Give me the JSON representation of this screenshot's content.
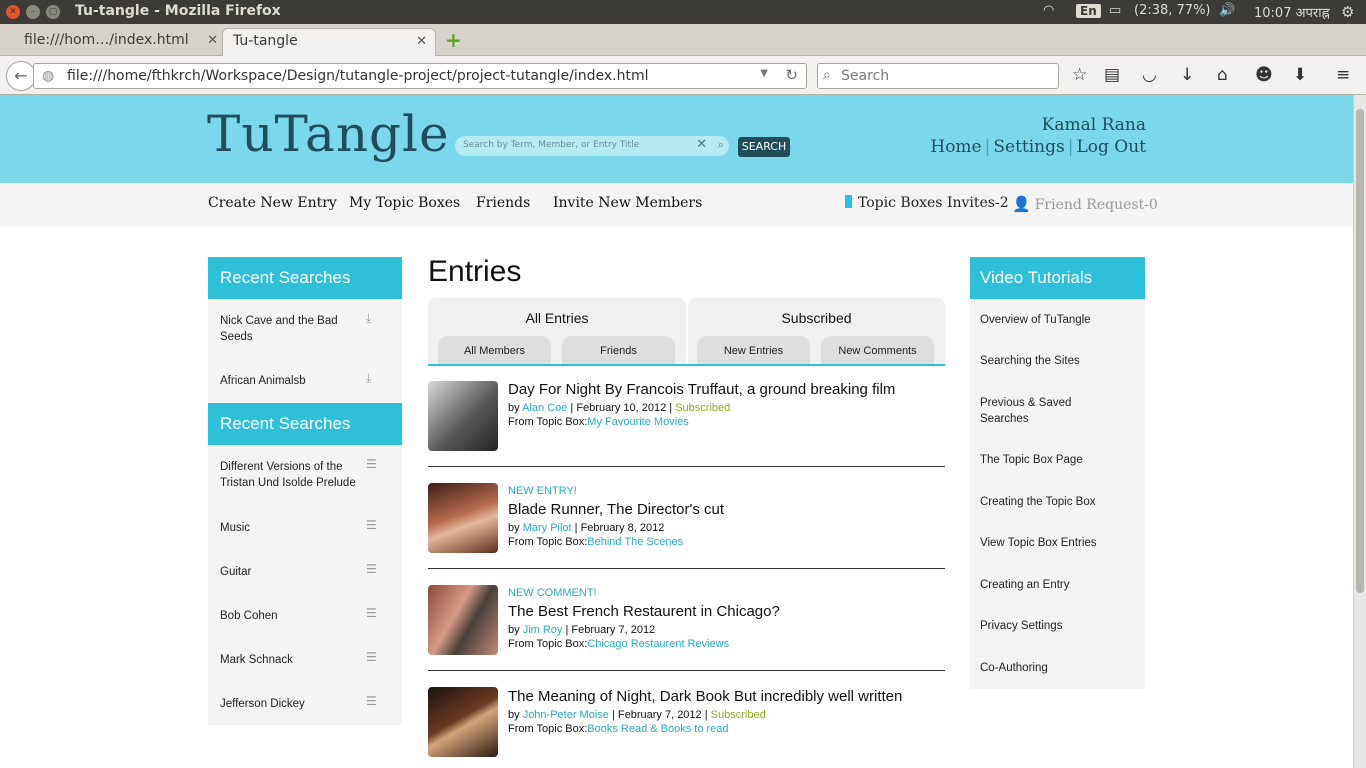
{
  "os": {
    "window_title": "Tu-tangle - Mozilla Firefox",
    "lang": "En",
    "battery": "(2:38, 77%)",
    "clock": "10:07 अपराह्न"
  },
  "browser": {
    "tabs": [
      {
        "label": "file:///hom…/index.html"
      },
      {
        "label": "Tu-tangle"
      }
    ],
    "url": "file:///home/fthkrch/Workspace/Design/tutangle-project/project-tutangle/index.html",
    "search_placeholder": "Search"
  },
  "site": {
    "logo": "TuTangle",
    "search_placeholder": "Search by Term, Member, or Entry Title",
    "search_button": "SEARCH",
    "user_name": "Kamal Rana",
    "header_links": [
      "Home",
      "Settings",
      "Log Out"
    ],
    "nav": [
      "Create New Entry",
      "My Topic Boxes",
      "Friends",
      "Invite New Members"
    ],
    "topic_invites": "Topic Boxes Invites-2",
    "friend_requests": "Friend Request-0"
  },
  "left": {
    "recent1_title": "Recent Searches",
    "recent1": [
      "Nick Cave and the Bad Seeds",
      "African Animalsb"
    ],
    "recent2_title": "Recent Searches",
    "recent2": [
      "Different Versions of the Tristan Und Isolde Prelude",
      "Music",
      "Guitar",
      "Bob Cohen",
      "Mark Schnack",
      "Jefferson Dickey"
    ]
  },
  "main": {
    "title": "Entries",
    "tab_groups": [
      {
        "label": "All Entries",
        "subtabs": [
          "All Members",
          "Friends"
        ]
      },
      {
        "label": "Subscribed",
        "subtabs": [
          "New Entries",
          "New Comments"
        ]
      }
    ],
    "by": "by",
    "from_label": "From Topic Box:",
    "entries": [
      {
        "tag": "",
        "title": "Day For Night By Francois Truffaut, a ground breaking film",
        "author": "Alan Coe",
        "date": "February 10, 2012",
        "subscribed": "Subscribed",
        "topic": "My Favourite Movies"
      },
      {
        "tag": "NEW ENTRY!",
        "title": "Blade Runner, The Director's cut",
        "author": "Mary Pilot",
        "date": "February 8, 2012",
        "subscribed": "",
        "topic": "Behind The Scenes"
      },
      {
        "tag": "NEW COMMENT!",
        "title": "The Best French Restaurent in Chicago?",
        "author": "Jim Roy",
        "date": "February 7, 2012",
        "subscribed": "",
        "topic": "Chicago Restaurent Reviews"
      },
      {
        "tag": "",
        "title": "The Meaning of Night, Dark Book But incredibly well written",
        "author": "John-Peter Moise",
        "date": "February 7, 2012",
        "subscribed": "Subscribed",
        "topic": "Books Read & Books to read"
      }
    ]
  },
  "right": {
    "title": "Video Tutorials",
    "items": [
      "Overview of TuTangle",
      "Searching the Sites",
      "Previous & Saved Searches",
      "The Topic Box Page",
      "Creating the Topic Box",
      "View Topic Box Entries",
      "Creating an Entry",
      "Privacy Settings",
      "Co-Authoring"
    ]
  }
}
